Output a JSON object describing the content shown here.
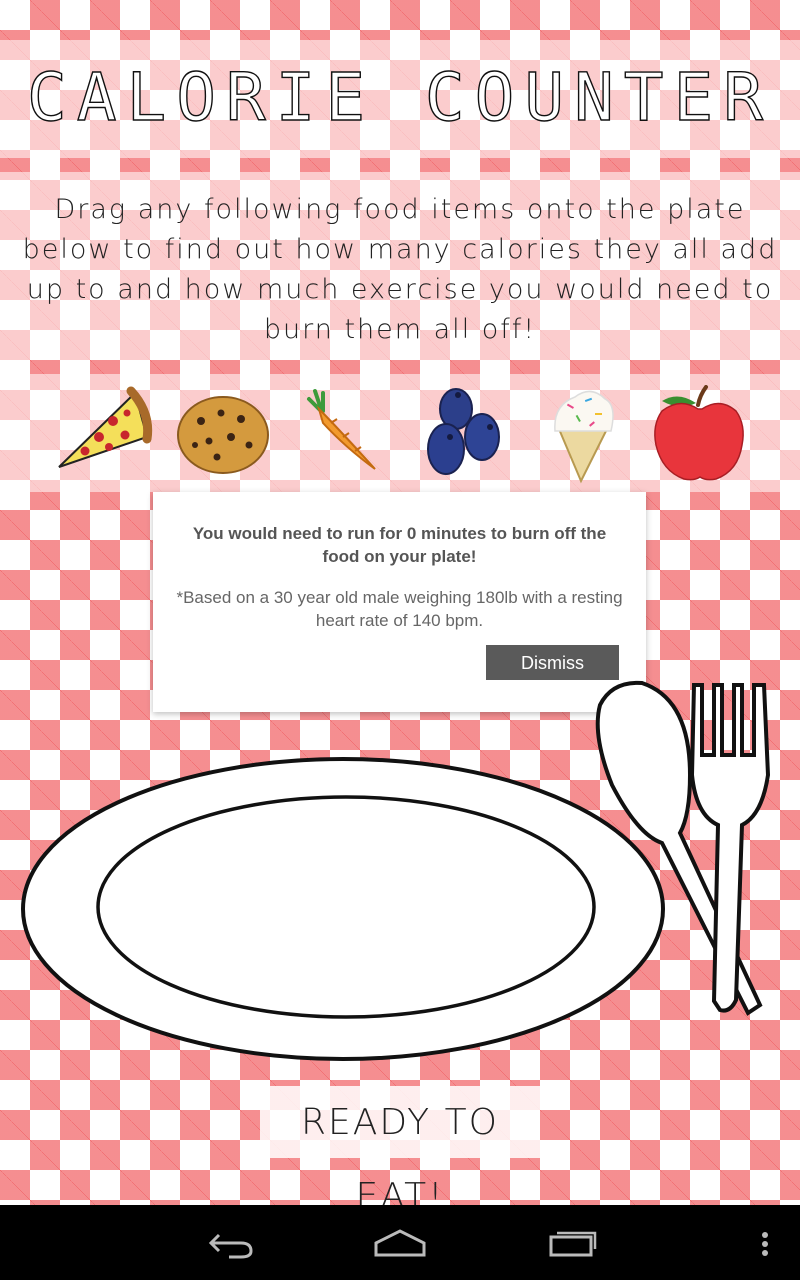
{
  "header": {
    "title": "CALORIE COUNTER"
  },
  "intro": {
    "text": "Drag any following food items onto the plate below to find out how many calories they all add up to and how much exercise you would need to burn them all off!"
  },
  "foods": [
    {
      "icon": "pizza-slice-icon"
    },
    {
      "icon": "cookie-icon"
    },
    {
      "icon": "carrot-icon"
    },
    {
      "icon": "blueberries-icon"
    },
    {
      "icon": "ice-cream-cone-icon"
    },
    {
      "icon": "apple-icon"
    }
  ],
  "dialog": {
    "message": "You would need to run for 0 minutes to burn off the food on your plate!",
    "footnote": "*Based on a 30 year old male weighing 180lb with a resting heart rate of 140 bpm.",
    "dismiss_label": "Dismiss"
  },
  "plate": {
    "icon": "plate-icon"
  },
  "cutlery": {
    "icons": [
      "spoon-icon",
      "fork-icon"
    ]
  },
  "action": {
    "ready_label": "READY TO EAT!"
  },
  "navigation": {
    "buttons": [
      "back-icon",
      "home-icon",
      "recent-apps-icon",
      "overflow-menu-icon"
    ]
  },
  "colors": {
    "gingham": "#eb1e23",
    "dialog_button": "#5a5a5a",
    "nav_bar": "#000000"
  }
}
